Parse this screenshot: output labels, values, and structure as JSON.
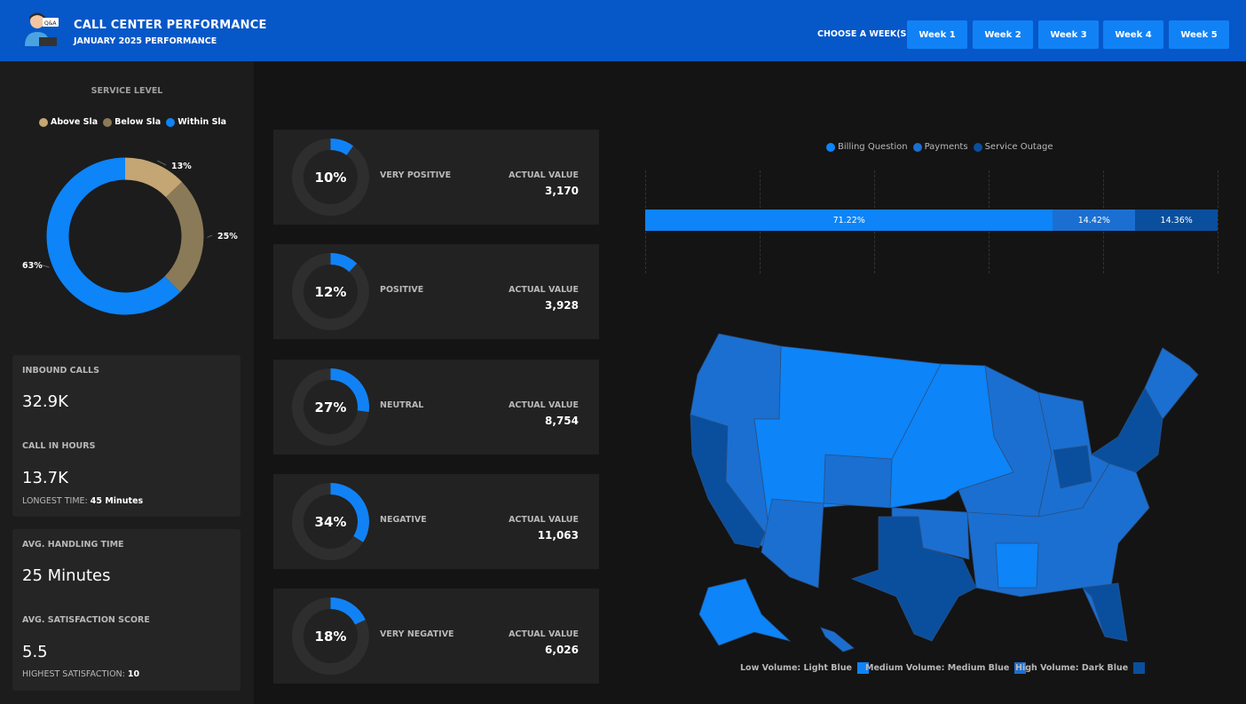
{
  "header": {
    "title": "CALL CENTER PERFORMANCE",
    "subtitle": "JANUARY 2025 PERFORMANCE",
    "week_label": "CHOOSE A WEEK(S)",
    "weeks": [
      "Week 1",
      "Week 2",
      "Week 3",
      "Week 4",
      "Week 5"
    ],
    "brand_color": "#0657c8",
    "button_color": "#1182f5"
  },
  "service_level": {
    "title": "SERVICE LEVEL",
    "legend": [
      {
        "label": "Above Sla",
        "color": "#c4a574"
      },
      {
        "label": "Below Sla",
        "color": "#8a7a58"
      },
      {
        "label": "Within Sla",
        "color": "#0d84f8"
      }
    ],
    "slices": [
      {
        "label": "13%",
        "value": 13,
        "color": "#c4a574"
      },
      {
        "label": "25%",
        "value": 25,
        "color": "#8a7a58"
      },
      {
        "label": "63%",
        "value": 63,
        "color": "#0d84f8"
      }
    ]
  },
  "kpis": {
    "inbound_label": "INBOUND CALLS",
    "inbound_value": "32.9K",
    "hours_label": "CALL IN HOURS",
    "hours_value": "13.7K",
    "longest_label": "LONGEST TIME:",
    "longest_value": "45 Minutes",
    "aht_label": "AVG. HANDLING TIME",
    "aht_value": "25 Minutes",
    "sat_label": "AVG. SATISFACTION SCORE",
    "sat_value": "5.5",
    "highest_label": "HIGHEST SATISFACTION:",
    "highest_value": "10"
  },
  "sentiment": [
    {
      "pct_label": "10%",
      "pct": 10,
      "name": "VERY POSITIVE",
      "actual_label": "ACTUAL VALUE",
      "value": "3,170"
    },
    {
      "pct_label": "12%",
      "pct": 12,
      "name": "POSITIVE",
      "actual_label": "ACTUAL VALUE",
      "value": "3,928"
    },
    {
      "pct_label": "27%",
      "pct": 27,
      "name": "NEUTRAL",
      "actual_label": "ACTUAL VALUE",
      "value": "8,754"
    },
    {
      "pct_label": "34%",
      "pct": 34,
      "name": "NEGATIVE",
      "actual_label": "ACTUAL VALUE",
      "value": "11,063"
    },
    {
      "pct_label": "18%",
      "pct": 18,
      "name": "VERY NEGATIVE",
      "actual_label": "ACTUAL VALUE",
      "value": "6,026"
    }
  ],
  "chart_data": {
    "type": "bar",
    "categories": [
      ""
    ],
    "series": [
      {
        "name": "Billing Question",
        "values": [
          71.22
        ],
        "label": "71.22%",
        "color": "#0d84f8"
      },
      {
        "name": "Payments",
        "values": [
          14.42
        ],
        "label": "14.42%",
        "color": "#1b6fd1"
      },
      {
        "name": "Service Outage",
        "values": [
          14.36
        ],
        "label": "14.36%",
        "color": "#0a4f9e"
      }
    ],
    "stacked": true,
    "orientation": "horizontal",
    "ylim": [
      0,
      100
    ]
  },
  "map_legend": {
    "low": "Low Volume: Light Blue",
    "medium": "Medium Volume: Medium Blue",
    "high": "High Volume: Dark Blue",
    "low_color": "#0d84f8",
    "medium_color": "#1b6fd1",
    "high_color": "#0a4f9e"
  }
}
